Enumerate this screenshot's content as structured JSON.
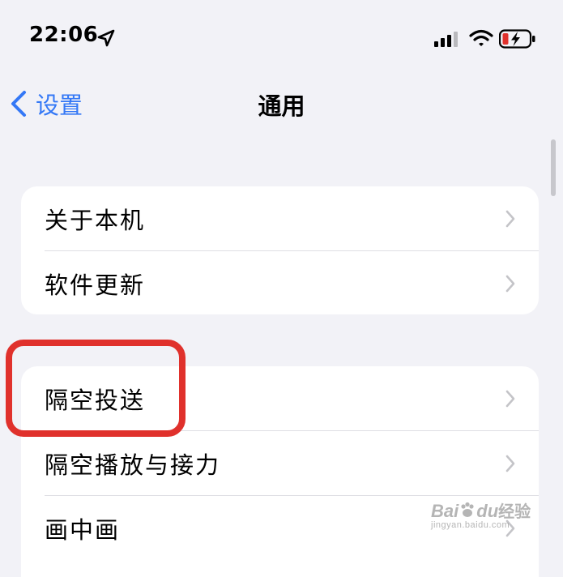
{
  "status_bar": {
    "time": "22:06",
    "icons": [
      "location-arrow-icon",
      "cellular-signal-icon",
      "wifi-icon",
      "battery-charging-icon"
    ]
  },
  "nav": {
    "back_label": "设置",
    "title": "通用"
  },
  "groups": [
    {
      "items": [
        {
          "label": "关于本机"
        },
        {
          "label": "软件更新"
        }
      ]
    },
    {
      "items": [
        {
          "label": "隔空投送"
        },
        {
          "label": "隔空播放与接力"
        },
        {
          "label": "画中画"
        }
      ]
    }
  ],
  "highlight": {
    "target": "隔空投送",
    "color": "#e0312c"
  },
  "colors": {
    "accent": "#3478f6",
    "background": "#f2f2f7",
    "battery_low": "#e0312c"
  },
  "watermark": {
    "brand": "Bai",
    "paw": "du",
    "suffix": "经验",
    "url": "jingyan.baidu.com"
  }
}
